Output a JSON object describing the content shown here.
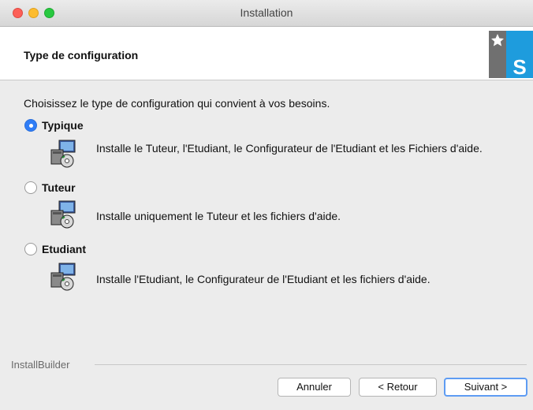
{
  "window": {
    "title": "Installation"
  },
  "header": {
    "title": "Type de configuration"
  },
  "main": {
    "intro": "Choisissez le type de configuration qui convient à vos besoins.",
    "options": [
      {
        "label": "Typique",
        "selected": true,
        "icon": "installer-package-icon",
        "description": "Installe le Tuteur, l'Etudiant, le Configurateur de l'Etudiant et les Fichiers d'aide."
      },
      {
        "label": "Tuteur",
        "selected": false,
        "icon": "installer-package-icon",
        "description": "Installe uniquement le Tuteur et les fichiers d'aide."
      },
      {
        "label": "Etudiant",
        "selected": false,
        "icon": "installer-package-icon",
        "description": "Installe l'Etudiant, le Configurateur de l'Etudiant et les fichiers d'aide."
      }
    ]
  },
  "footer": {
    "brand": "InstallBuilder",
    "cancel_label": "Annuler",
    "back_label": "< Retour",
    "next_label": "Suivant >"
  },
  "colors": {
    "accent": "#2f7df6",
    "close": "#fc5f57",
    "minimize": "#fdbc2e",
    "maximize": "#28c840"
  }
}
